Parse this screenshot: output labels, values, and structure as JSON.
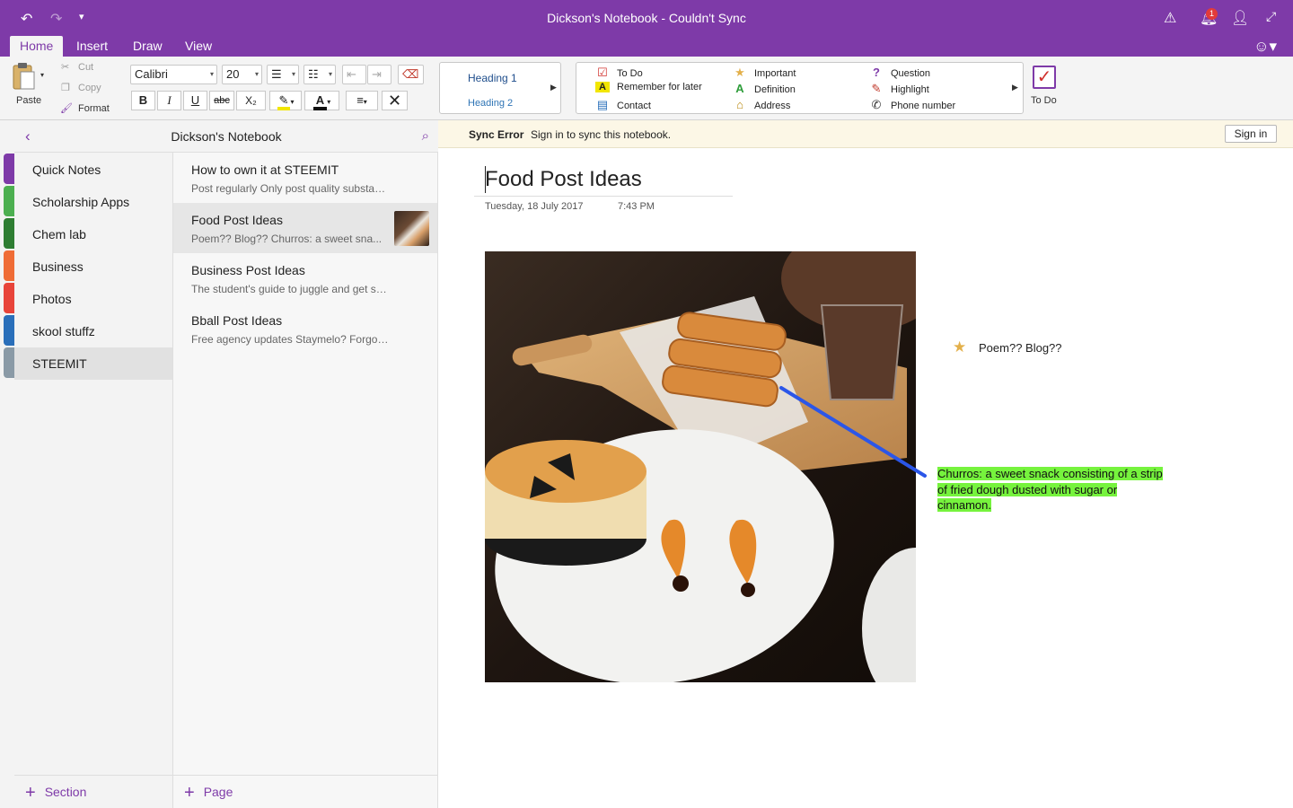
{
  "window": {
    "title": "Dickson's Notebook - Couldn't Sync",
    "notification_count": "1"
  },
  "ribbon_tabs": [
    "Home",
    "Insert",
    "Draw",
    "View"
  ],
  "clipboard": {
    "paste": "Paste",
    "cut": "Cut",
    "copy": "Copy",
    "format": "Format"
  },
  "font": {
    "family": "Calibri",
    "size": "20"
  },
  "format_buttons": {
    "bold": "B",
    "italic": "I",
    "underline": "U",
    "strike": "abc",
    "subscript": "X₂"
  },
  "styles": {
    "heading1": "Heading 1",
    "heading2": "Heading 2"
  },
  "tags": [
    {
      "label": "To Do",
      "icon": "checkbox-icon"
    },
    {
      "label": "Remember for later",
      "icon": "highlight-a-icon"
    },
    {
      "label": "Contact",
      "icon": "contact-card-icon"
    },
    {
      "label": "Important",
      "icon": "star-icon"
    },
    {
      "label": "Definition",
      "icon": "definition-a-icon"
    },
    {
      "label": "Address",
      "icon": "house-icon"
    },
    {
      "label": "Question",
      "icon": "question-icon"
    },
    {
      "label": "Highlight",
      "icon": "pen-icon"
    },
    {
      "label": "Phone number",
      "icon": "phone-icon"
    }
  ],
  "todo_button": "To Do",
  "notebook": {
    "name": "Dickson's Notebook"
  },
  "sections": [
    {
      "label": "Quick Notes",
      "color": "#7e3aa8"
    },
    {
      "label": "Scholarship Apps",
      "color": "#4caf50"
    },
    {
      "label": "Chem lab",
      "color": "#2e7d32"
    },
    {
      "label": "Business",
      "color": "#ef6c36"
    },
    {
      "label": "Photos",
      "color": "#e8443a"
    },
    {
      "label": "skool stuffz",
      "color": "#2a6fba"
    },
    {
      "label": "STEEMIT",
      "color": "#8a9aa6"
    }
  ],
  "pages": [
    {
      "title": "How to own it at STEEMIT",
      "preview": "Post regularly  Only post quality substance"
    },
    {
      "title": "Food Post Ideas",
      "preview": "Poem?? Blog??  Churros: a sweet sna..."
    },
    {
      "title": "Business Post Ideas",
      "preview": "The student's guide to juggle and get shit do..."
    },
    {
      "title": "Bball Post Ideas",
      "preview": "Free agency updates  Staymelo?  Forgotten l..."
    }
  ],
  "footer": {
    "add_section": "Section",
    "add_page": "Page"
  },
  "sync": {
    "error_label": "Sync Error",
    "message": "Sign in to sync this notebook.",
    "signin": "Sign in"
  },
  "page": {
    "title": "Food Post Ideas",
    "date": "Tuesday, 18 July 2017",
    "time": "7:43 PM",
    "note": "Poem?? Blog??",
    "definition_term": "Churros:",
    "definition_text": " a sweet snack consisting of a strip of fried dough dusted with sugar or cinnamon."
  },
  "colors": {
    "accent": "#7e3aa8",
    "highlight": "#76f33d",
    "pointer": "#2b56e8"
  }
}
